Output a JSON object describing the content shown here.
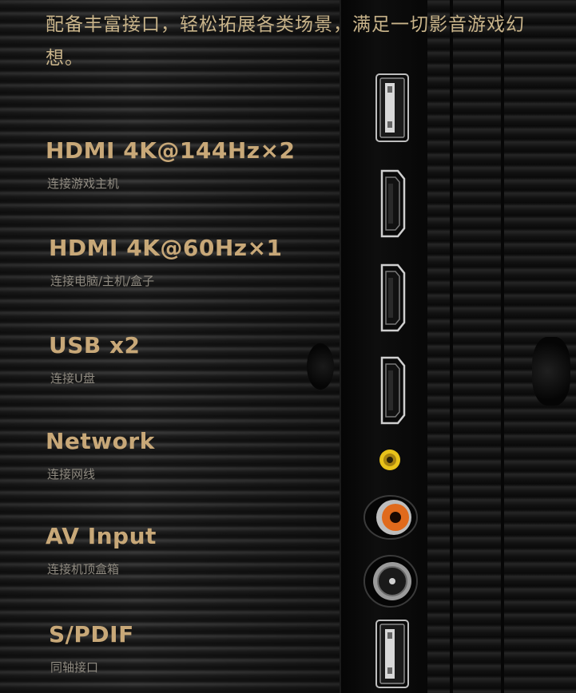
{
  "intro": {
    "text": "配备丰富接口，轻松拓展各类场景，满足一切影音游戏幻想。"
  },
  "specs": [
    {
      "title": "HDMI 4K@144Hz×2",
      "subtitle": "连接游戏主机"
    },
    {
      "title": "HDMI 4K@60Hz×1",
      "subtitle": "连接电脑/主机/盒子"
    },
    {
      "title": "USB x2",
      "subtitle": "连接U盘"
    },
    {
      "title": "Network",
      "subtitle": "连接网线"
    },
    {
      "title": "AV Input",
      "subtitle": "连接机顶盒箱"
    },
    {
      "title": "S/PDIF",
      "subtitle": "同轴接口"
    }
  ],
  "ports": [
    {
      "icon": "usb-port-icon"
    },
    {
      "icon": "hdmi-port-icon"
    },
    {
      "icon": "hdmi-port-icon"
    },
    {
      "icon": "hdmi-port-icon"
    },
    {
      "icon": "network-port-icon"
    },
    {
      "icon": "av-rca-port-icon"
    },
    {
      "icon": "coaxial-port-icon"
    },
    {
      "icon": "usb-port-icon"
    }
  ],
  "colors": {
    "title_gold": "#c8a878",
    "intro_gold": "#c9b48a",
    "subtitle_gray": "#8f8a80",
    "rca_orange": "#e06a1c",
    "network_yellow": "#e8c21a"
  }
}
